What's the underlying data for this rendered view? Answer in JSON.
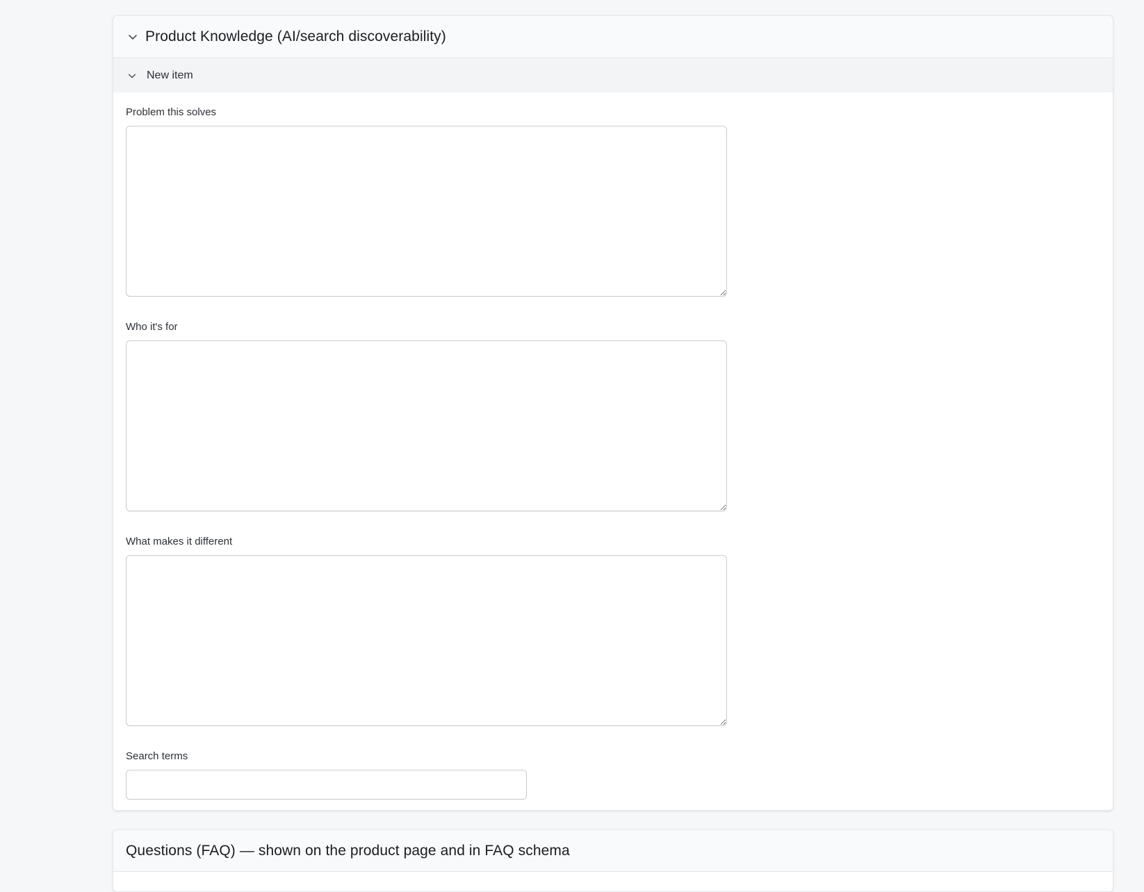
{
  "knowledge_section": {
    "title": "Product Knowledge (AI/search discoverability)",
    "item": {
      "title": "New item",
      "fields": {
        "problem": {
          "label": "Problem this solves",
          "value": ""
        },
        "audience": {
          "label": "Who it's for",
          "value": ""
        },
        "difference": {
          "label": "What makes it different",
          "value": ""
        },
        "search_terms": {
          "label": "Search terms",
          "value": ""
        }
      }
    }
  },
  "faq_section": {
    "title": "Questions (FAQ) — shown on the product page and in FAQ schema"
  },
  "icons": {
    "section_toggle": "chevron-down-icon",
    "item_toggle": "chevron-down-icon"
  },
  "colors": {
    "page_bg": "#f6f7f8",
    "panel_header_bg": "#f9fafb",
    "item_header_bg": "#f3f4f6",
    "border": "#c9ccd1"
  }
}
